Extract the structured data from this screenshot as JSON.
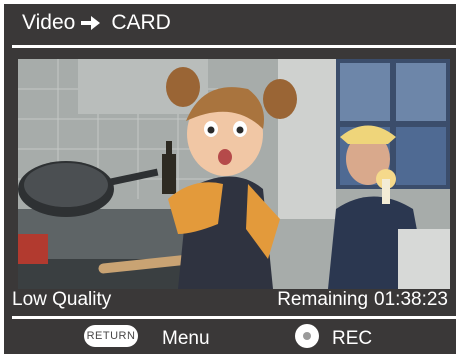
{
  "header": {
    "source": "Video",
    "destination": "CARD"
  },
  "preview": {
    "description_icon": "video-preview-image"
  },
  "status": {
    "quality": "Low Quality",
    "remaining_label": "Remaining",
    "remaining_time": "01:38:23"
  },
  "footer": {
    "return_label": "RETURN",
    "menu_label": "Menu",
    "rec_label": "REC"
  },
  "colors": {
    "background": "#3a3838",
    "text": "#ffffff",
    "button": "#ffffff"
  }
}
